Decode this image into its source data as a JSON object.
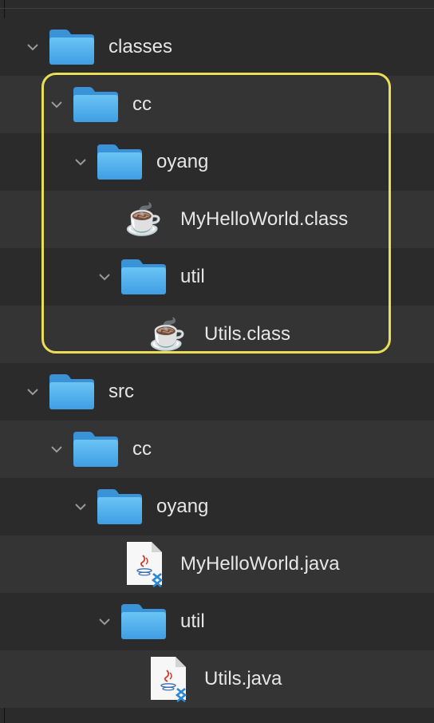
{
  "tree": {
    "items": [
      {
        "label": "classes",
        "kind": "folder",
        "expanded": true
      },
      {
        "label": "cc",
        "kind": "folder",
        "expanded": true
      },
      {
        "label": "oyang",
        "kind": "folder",
        "expanded": true
      },
      {
        "label": "MyHelloWorld.class",
        "kind": "class-file"
      },
      {
        "label": "util",
        "kind": "folder",
        "expanded": true
      },
      {
        "label": "Utils.class",
        "kind": "class-file"
      },
      {
        "label": "src",
        "kind": "folder",
        "expanded": true
      },
      {
        "label": "cc",
        "kind": "folder",
        "expanded": true
      },
      {
        "label": "oyang",
        "kind": "folder",
        "expanded": true
      },
      {
        "label": "MyHelloWorld.java",
        "kind": "java-file"
      },
      {
        "label": "util",
        "kind": "folder",
        "expanded": true
      },
      {
        "label": "Utils.java",
        "kind": "java-file"
      }
    ]
  },
  "colors": {
    "background": "#2b2b2b",
    "row_alt": "#343434",
    "highlight_border": "#e9de58",
    "folder_blue": "#5ab5ef",
    "text": "#e6e6e6"
  }
}
